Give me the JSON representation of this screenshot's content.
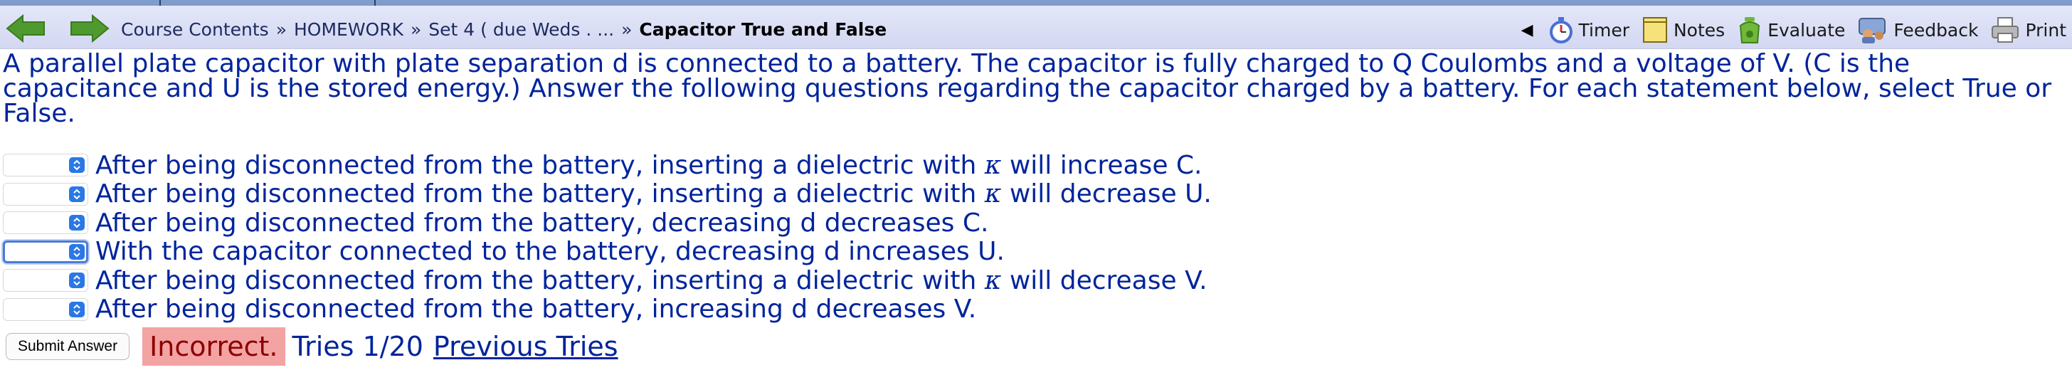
{
  "nav": {
    "back_icon": "left-arrow-icon",
    "forward_icon": "right-arrow-icon",
    "breadcrumb": [
      "Course Contents",
      "HOMEWORK",
      "Set 4 ( due Weds . ..."
    ],
    "separator": "»",
    "current": "Capacitor True and False",
    "collapse_glyph": "◀",
    "tools": [
      {
        "label": "Timer",
        "icon": "stopwatch-icon"
      },
      {
        "label": "Notes",
        "icon": "notepad-icon"
      },
      {
        "label": "Evaluate",
        "icon": "evaluate-icon"
      },
      {
        "label": "Feedback",
        "icon": "feedback-icon"
      },
      {
        "label": "Print",
        "icon": "printer-icon"
      }
    ]
  },
  "problem": {
    "text": "A parallel plate capacitor with plate separation d is connected to a battery. The capacitor is fully charged to Q Coulombs and a voltage of V. (C is the capacitance and U is the stored energy.) Answer the following questions regarding the capacitor charged by a battery. For each statement below, select True or False."
  },
  "statements": [
    {
      "pre": "After being disconnected from the battery, inserting a dielectric with ",
      "kappa": "κ",
      "post": " will increase C.",
      "value": ""
    },
    {
      "pre": "After being disconnected from the battery, inserting a dielectric with ",
      "kappa": "κ",
      "post": " will decrease U.",
      "value": ""
    },
    {
      "pre": "After being disconnected from the battery, decreasing d decreases C.",
      "kappa": "",
      "post": "",
      "value": ""
    },
    {
      "pre": "With the capacitor connected to the battery, decreasing d increases U.",
      "kappa": "",
      "post": "",
      "value": ""
    },
    {
      "pre": "After being disconnected from the battery, inserting a dielectric with ",
      "kappa": "κ",
      "post": " will decrease V.",
      "value": ""
    },
    {
      "pre": "After being disconnected from the battery, increasing d decreases V.",
      "kappa": "",
      "post": "",
      "value": ""
    }
  ],
  "submit": {
    "button_label": "Submit Answer",
    "status": "Incorrect.",
    "tries": "Tries 1/20",
    "previous_tries": "Previous Tries"
  },
  "colors": {
    "question_text": "#00249c",
    "status_bg": "#f4a3a3",
    "status_text": "#8b0000",
    "navbar": "#dcdff5",
    "arrow_green": "#4f9a2e"
  }
}
